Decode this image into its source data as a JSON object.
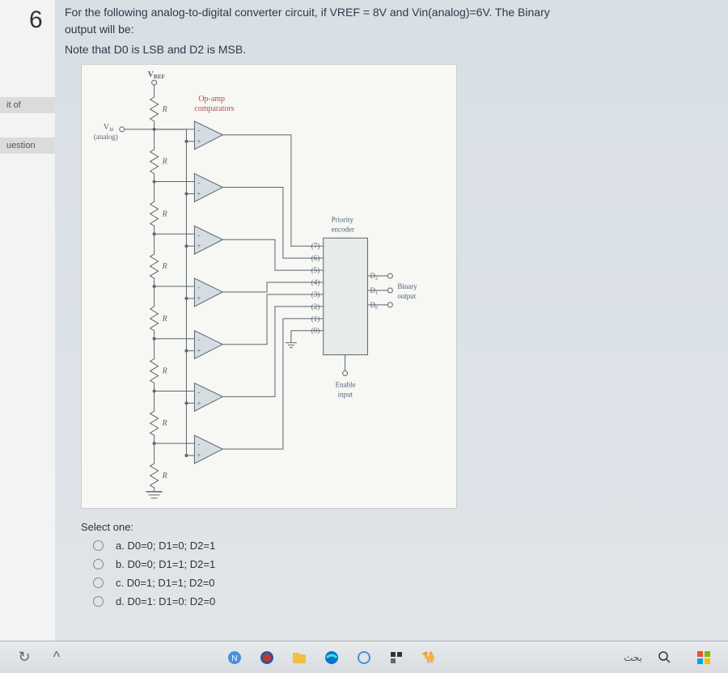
{
  "question_number": "6",
  "sidebar": {
    "tag1": "it of",
    "tag2": "uestion"
  },
  "question": {
    "text_line1": "For the following analog-to-digital converter circuit, if VREF = 8V and Vin(analog)=6V. The Binary",
    "text_line2": "output will be:",
    "note": "Note that D0 is LSB and D2 is MSB."
  },
  "diagram": {
    "vref": "V",
    "vref_sub": "REF",
    "r_label": "R",
    "opamp": "Op-amp",
    "comparators": "comparators",
    "vin": "V",
    "vin_sub": "in",
    "analog": "(analog)",
    "priority": "Priority",
    "encoder": "encoder",
    "enable": "Enable",
    "input": "input",
    "binary": "Binary",
    "output": "output",
    "d2": "D",
    "d2_sub": "2",
    "d1": "D",
    "d1_sub": "1",
    "d0": "D",
    "d0_sub": "0",
    "pin7": "(7)",
    "pin6": "(6)",
    "pin5": "(5)",
    "pin4": "(4)",
    "pin3": "(3)",
    "pin2": "(2)",
    "pin1": "(1)",
    "pin0": "(0)"
  },
  "answers": {
    "select_one": "Select one:",
    "option_a": "a. D0=0; D1=0; D2=1",
    "option_b": "b. D0=0; D1=1; D2=1",
    "option_c": "c. D0=1; D1=1; D2=0",
    "option_d": "d. D0=1: D1=0: D2=0"
  },
  "taskbar": {
    "search": "بحث"
  }
}
